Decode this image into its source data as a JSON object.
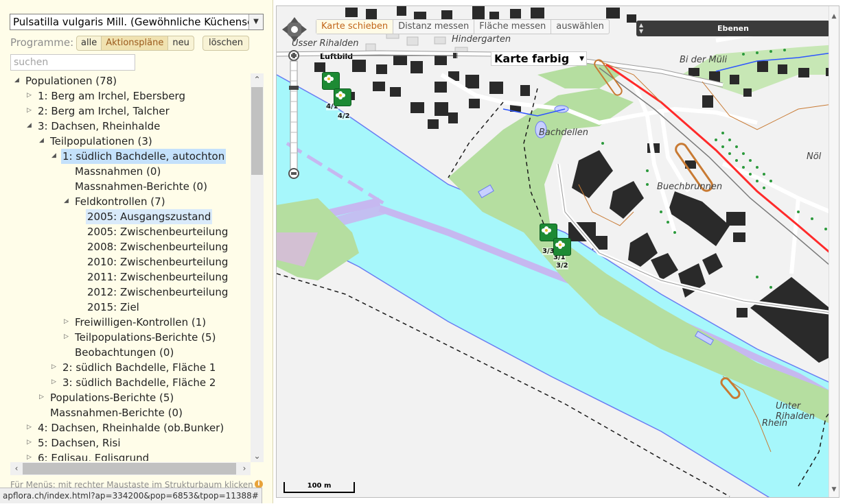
{
  "sidebar": {
    "species_select": "Pulsatilla vulgaris Mill. (Gewöhnliche Küchensc",
    "programme_label": "Programme:",
    "programme_buttons": [
      "alle",
      "Aktionspläne",
      "neu"
    ],
    "clear_button": "löschen",
    "search_placeholder": "suchen",
    "tree": [
      {
        "label": "Populationen (78)",
        "level": 0,
        "toggle": "open"
      },
      {
        "label": "1: Berg am Irchel, Ebersberg",
        "level": 1,
        "toggle": "closed"
      },
      {
        "label": "2: Berg am Irchel, Talcher",
        "level": 1,
        "toggle": "closed"
      },
      {
        "label": "3: Dachsen, Rheinhalde",
        "level": 1,
        "toggle": "open"
      },
      {
        "label": "Teilpopulationen (3)",
        "level": 2,
        "toggle": "open"
      },
      {
        "label": "1: südlich Bachdelle, autochton",
        "level": 3,
        "toggle": "open",
        "state": "selected"
      },
      {
        "label": "Massnahmen (0)",
        "level": 4,
        "toggle": "none"
      },
      {
        "label": "Massnahmen-Berichte (0)",
        "level": 4,
        "toggle": "none"
      },
      {
        "label": "Feldkontrollen (7)",
        "level": 4,
        "toggle": "open"
      },
      {
        "label": "2005: Ausgangszustand",
        "level": 5,
        "toggle": "none",
        "state": "highlight"
      },
      {
        "label": "2005: Zwischenbeurteilung",
        "level": 5,
        "toggle": "none"
      },
      {
        "label": "2008: Zwischenbeurteilung",
        "level": 5,
        "toggle": "none"
      },
      {
        "label": "2010: Zwischenbeurteilung",
        "level": 5,
        "toggle": "none"
      },
      {
        "label": "2011: Zwischenbeurteilung",
        "level": 5,
        "toggle": "none"
      },
      {
        "label": "2012: Zwischenbeurteilung",
        "level": 5,
        "toggle": "none"
      },
      {
        "label": "2015: Ziel",
        "level": 5,
        "toggle": "none"
      },
      {
        "label": "Freiwilligen-Kontrollen (1)",
        "level": 4,
        "toggle": "closed"
      },
      {
        "label": "Teilpopulations-Berichte (5)",
        "level": 4,
        "toggle": "closed"
      },
      {
        "label": "Beobachtungen (0)",
        "level": 4,
        "toggle": "none"
      },
      {
        "label": "2: südlich Bachdelle, Fläche 1",
        "level": 3,
        "toggle": "closed"
      },
      {
        "label": "3: südlich Bachdelle, Fläche 2",
        "level": 3,
        "toggle": "closed"
      },
      {
        "label": "Populations-Berichte (5)",
        "level": 2,
        "toggle": "closed"
      },
      {
        "label": "Massnahmen-Berichte (0)",
        "level": 2,
        "toggle": "none"
      },
      {
        "label": "4: Dachsen, Rheinhalde (ob.Bunker)",
        "level": 1,
        "toggle": "closed"
      },
      {
        "label": "5: Dachsen, Risi",
        "level": 1,
        "toggle": "closed"
      },
      {
        "label": "6: Eglisau, Eglisgrund",
        "level": 1,
        "toggle": "closed"
      }
    ],
    "hint": "Für Menüs: mit rechter Maustaste im Strukturbaum klicken",
    "status_url": "apflora.ch/index.html?ap=334200&pop=6853&tpop=11388#"
  },
  "map": {
    "tools": [
      {
        "label": "Karte schieben",
        "active": true
      },
      {
        "label": "Distanz messen",
        "active": false
      },
      {
        "label": "Fläche messen",
        "active": false
      },
      {
        "label": "auswählen",
        "active": false
      }
    ],
    "layers_button": "Ebenen",
    "luftbild_label": "Luftbild",
    "base_map_select": "Karte farbig",
    "place_labels": [
      {
        "text": "Usser Rihalden",
        "id": "usser-rihalden"
      },
      {
        "text": "Hindergarten",
        "id": "hindergarten"
      },
      {
        "text": "Bi der Müli",
        "id": "bi-der-muli"
      },
      {
        "text": "Bachdellen",
        "id": "bachdellen"
      },
      {
        "text": "Nöl",
        "id": "nol"
      },
      {
        "text": "Buechbrunnen",
        "id": "buechbrunnen"
      },
      {
        "text": "Unter Rihalden",
        "id": "unter-rihalden"
      },
      {
        "text": "Rhein",
        "id": "rhein"
      }
    ],
    "markers": [
      {
        "label": "4/1"
      },
      {
        "label": "4/2"
      },
      {
        "label": "3/3"
      },
      {
        "label": "3/1"
      },
      {
        "label": "3/2"
      }
    ],
    "scale_label": "100 m",
    "colors": {
      "water": "#a6f7fb",
      "forest": "#b5dea0",
      "road_rail": "#ff2a2a",
      "building": "#262626",
      "accent": "#c1651a",
      "marker": "#1d8a34"
    }
  }
}
